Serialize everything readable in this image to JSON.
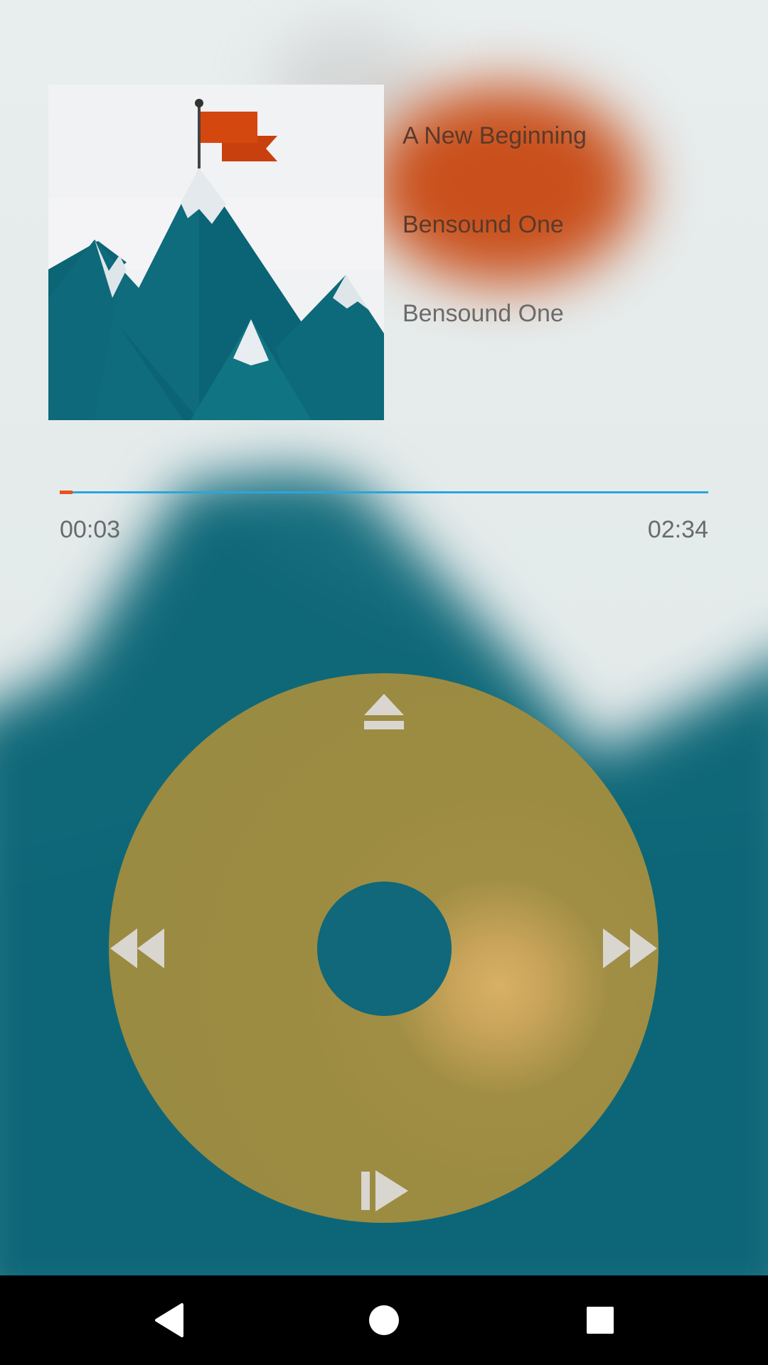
{
  "track": {
    "title": "A New Beginning",
    "artist": "Bensound One",
    "album": "Bensound One"
  },
  "progress": {
    "current_time": "00:03",
    "duration": "02:34",
    "fraction": 0.02
  },
  "colors": {
    "accent": "#e8501e",
    "progress_track": "#2aa6dc",
    "wheel": "#9c8c42",
    "wheel_center": "#10687a",
    "icon": "#d9d6cf"
  },
  "controls": {
    "top": "eject-icon",
    "left": "rewind-icon",
    "right": "fast-forward-icon",
    "bottom": "play-pause-icon"
  },
  "navbar": {
    "back": "back-triangle-icon",
    "home": "home-circle-icon",
    "recents": "recents-square-icon"
  }
}
